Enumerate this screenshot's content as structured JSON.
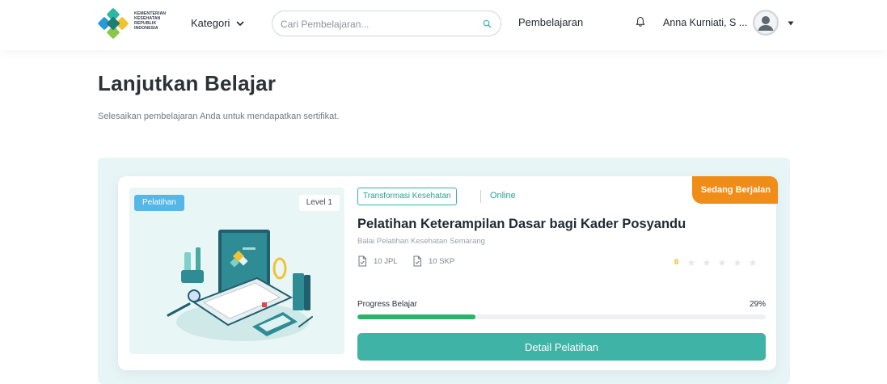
{
  "header": {
    "logo_lines": [
      "KEMENTERIAN",
      "KESEHATAN",
      "REPUBLIK",
      "INDONESIA"
    ],
    "kategori_label": "Kategori",
    "search_placeholder": "Cari Pembelajaran...",
    "search_value": "",
    "nav_label": "Pembelajaran",
    "user_name": "Anna Kurniati, S ..."
  },
  "page": {
    "title": "Lanjutkan Belajar",
    "subtitle": "Selesaikan pembelajaran Anda untuk mendapatkan sertifikat."
  },
  "course": {
    "type_badge": "Pelatihan",
    "level_badge": "Level 1",
    "topic": "Transformasi Kesehatan",
    "mode": "Online",
    "status": "Sedang Berjalan",
    "title": "Pelatihan Keterampilan Dasar bagi Kader Posyandu",
    "provider": "Balai Pelatihan Kesehatan Semarang",
    "jpl": "10 JPL",
    "skp": "10 SKP",
    "rating_value": "0",
    "rating_max": 5,
    "progress_label": "Progress Belajar",
    "progress_text": "29%",
    "progress_value": 29,
    "button_label": "Detail Pelatihan"
  },
  "colors": {
    "accent_teal": "#3fb3a6",
    "status_orange": "#f08c18",
    "progress_green": "#2bb36b",
    "badge_blue": "#55b6e8",
    "star_gold": "#f5b400"
  },
  "icons": {
    "search": "search-icon",
    "bell": "bell-icon",
    "chevron": "chevron-down-icon",
    "document": "document-icon",
    "star": "star-icon",
    "avatar": "user-avatar-icon"
  }
}
